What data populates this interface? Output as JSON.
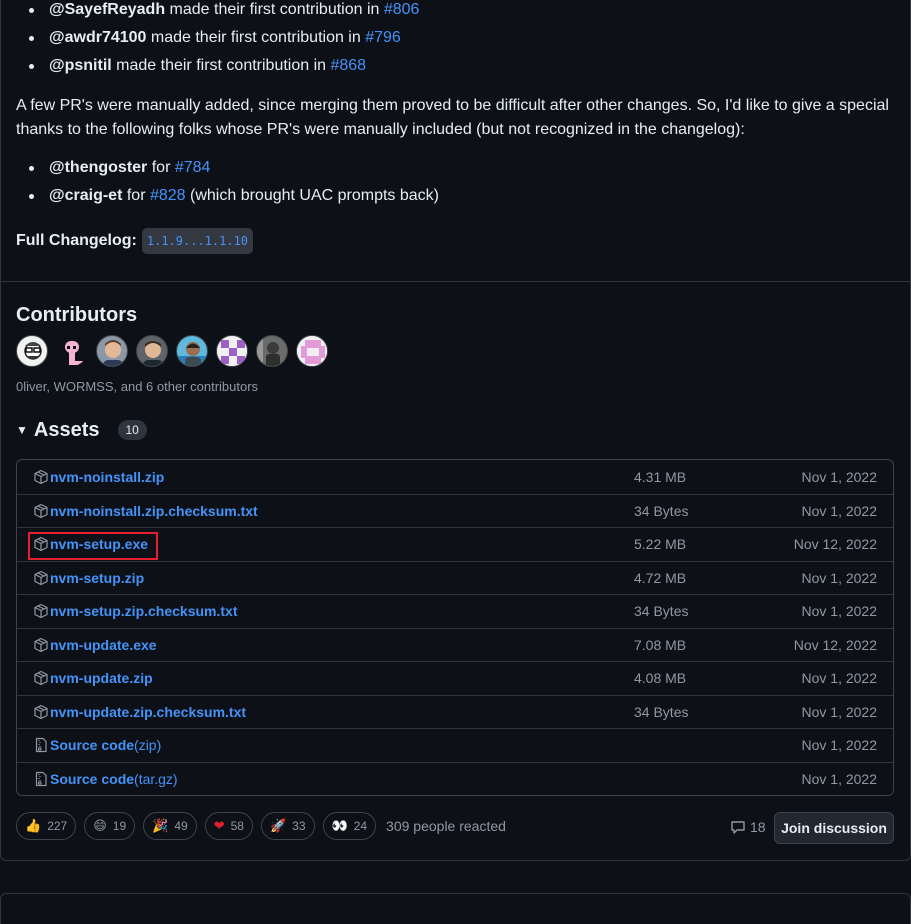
{
  "contributions": [
    {
      "user": "@SayefReyadh",
      "text": " made their first contribution in ",
      "pr": "#806"
    },
    {
      "user": "@awdr74100",
      "text": " made their first contribution in ",
      "pr": "#796"
    },
    {
      "user": "@psnitil",
      "text": " made their first contribution in ",
      "pr": "#868"
    }
  ],
  "paragraph": "A few PR's were manually added, since merging them proved to be difficult after other changes. So, I'd like to give a special thanks to the following folks whose PR's were manually included (but not recognized in the changelog):",
  "manual_prs": [
    {
      "user": "@thengoster",
      "pre": " for ",
      "pr": "#784",
      "post": ""
    },
    {
      "user": "@craig-et",
      "pre": " for ",
      "pr": "#828",
      "post": " (which brought UAC prompts back)"
    }
  ],
  "full_changelog": {
    "label": "Full Changelog:",
    "range": "1.1.9...1.1.10"
  },
  "contributors": {
    "title": "Contributors",
    "summary": "0liver, WORMSS, and 6 other contributors"
  },
  "assets": {
    "title": "Assets",
    "count": "10",
    "items": [
      {
        "name": "nvm-noinstall.zip",
        "suffix": "",
        "size": "4.31 MB",
        "date": "Nov 1, 2022",
        "icon": "package-icon"
      },
      {
        "name": "nvm-noinstall.zip.checksum.txt",
        "suffix": "",
        "size": "34 Bytes",
        "date": "Nov 1, 2022",
        "icon": "package-icon"
      },
      {
        "name": "nvm-setup.exe",
        "suffix": "",
        "size": "5.22 MB",
        "date": "Nov 12, 2022",
        "icon": "package-icon"
      },
      {
        "name": "nvm-setup.zip",
        "suffix": "",
        "size": "4.72 MB",
        "date": "Nov 1, 2022",
        "icon": "package-icon"
      },
      {
        "name": "nvm-setup.zip.checksum.txt",
        "suffix": "",
        "size": "34 Bytes",
        "date": "Nov 1, 2022",
        "icon": "package-icon"
      },
      {
        "name": "nvm-update.exe",
        "suffix": "",
        "size": "7.08 MB",
        "date": "Nov 12, 2022",
        "icon": "package-icon"
      },
      {
        "name": "nvm-update.zip",
        "suffix": "",
        "size": "4.08 MB",
        "date": "Nov 1, 2022",
        "icon": "package-icon"
      },
      {
        "name": "nvm-update.zip.checksum.txt",
        "suffix": "",
        "size": "34 Bytes",
        "date": "Nov 1, 2022",
        "icon": "package-icon"
      },
      {
        "name": "Source code",
        "suffix": " (zip)",
        "size": "",
        "date": "Nov 1, 2022",
        "icon": "file-zip-icon"
      },
      {
        "name": "Source code",
        "suffix": " (tar.gz)",
        "size": "",
        "date": "Nov 1, 2022",
        "icon": "file-zip-icon"
      }
    ]
  },
  "reactions": [
    {
      "emoji": "👍",
      "count": "227",
      "icon": "thumbs-up-icon"
    },
    {
      "emoji": "😄",
      "count": "19",
      "icon": "laugh-icon"
    },
    {
      "emoji": "🎉",
      "count": "49",
      "icon": "hooray-icon"
    },
    {
      "emoji": "❤",
      "count": "58",
      "icon": "heart-icon"
    },
    {
      "emoji": "🚀",
      "count": "33",
      "icon": "rocket-icon"
    },
    {
      "emoji": "👀",
      "count": "24",
      "icon": "eyes-icon"
    }
  ],
  "people_reacted": "309 people reacted",
  "comments": "18",
  "join_label": "Join discussion",
  "colors": {
    "link": "#4493f8",
    "bg": "#0d1117",
    "border": "#30363d",
    "highlight": "#e5202e"
  }
}
